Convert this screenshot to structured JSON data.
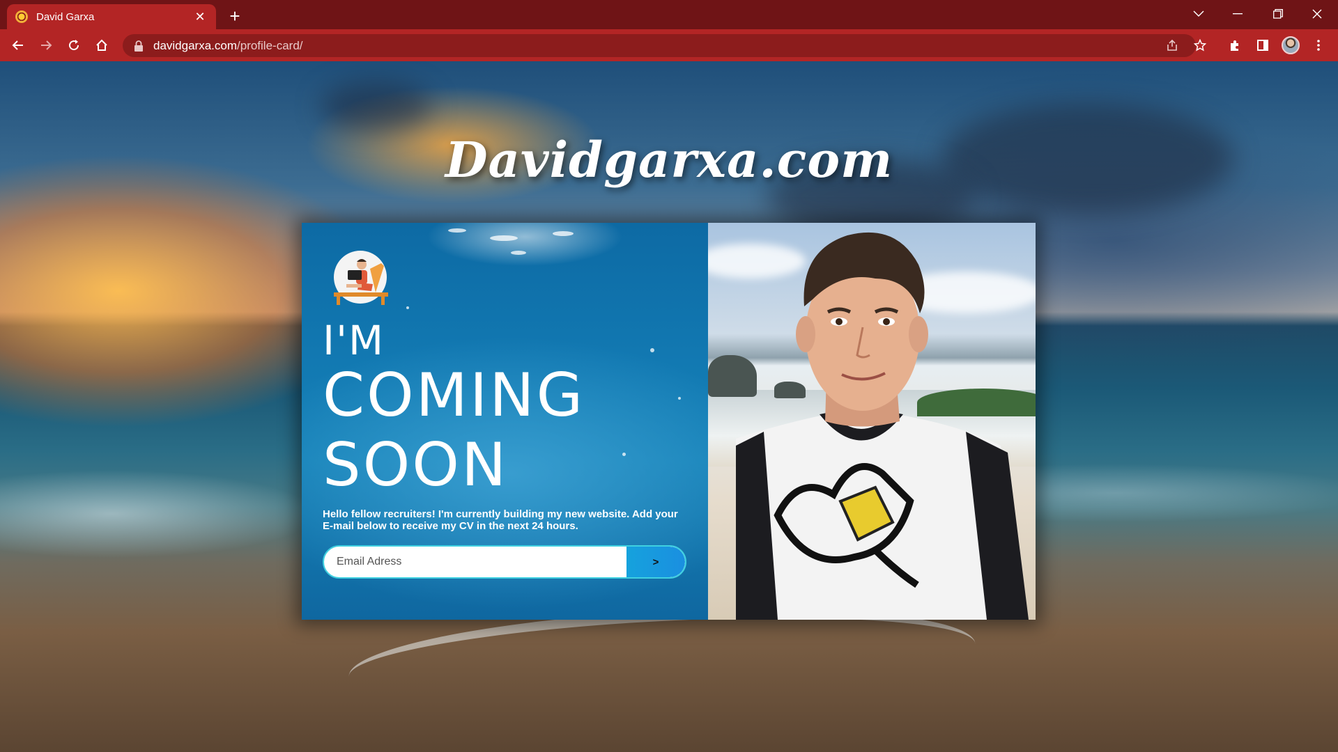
{
  "browser": {
    "tab_title": "David Garxa",
    "tab_close_glyph": "✕",
    "new_tab_glyph": "+",
    "url_host": "davidgarxa.com",
    "url_path": "/profile-card/"
  },
  "page": {
    "site_title": "Davidgarxa.com",
    "card": {
      "headline_line1": "I'M",
      "headline_line2": "COMING",
      "headline_line3": "SOON",
      "blurb": "Hello fellow recruiters! I'm currently building my new website. Add your E-mail below to receive my CV in the next 24 hours.",
      "email_placeholder": "Email Adress",
      "submit_label": ">"
    }
  },
  "colors": {
    "chrome_dark": "#6f1416",
    "chrome_toolbar": "#b32525",
    "card_blue": "#1279b2",
    "input_border": "#3fd0e0",
    "submit_button": "#16a2dd"
  },
  "icons": [
    "favicon-icon",
    "back-arrow-icon",
    "forward-arrow-icon",
    "reload-icon",
    "home-icon",
    "lock-icon",
    "share-icon",
    "star-icon",
    "extensions-icon",
    "side-panel-icon",
    "profile-avatar",
    "menu-icon",
    "chevron-down-icon",
    "minimize-icon",
    "restore-icon",
    "close-icon"
  ]
}
